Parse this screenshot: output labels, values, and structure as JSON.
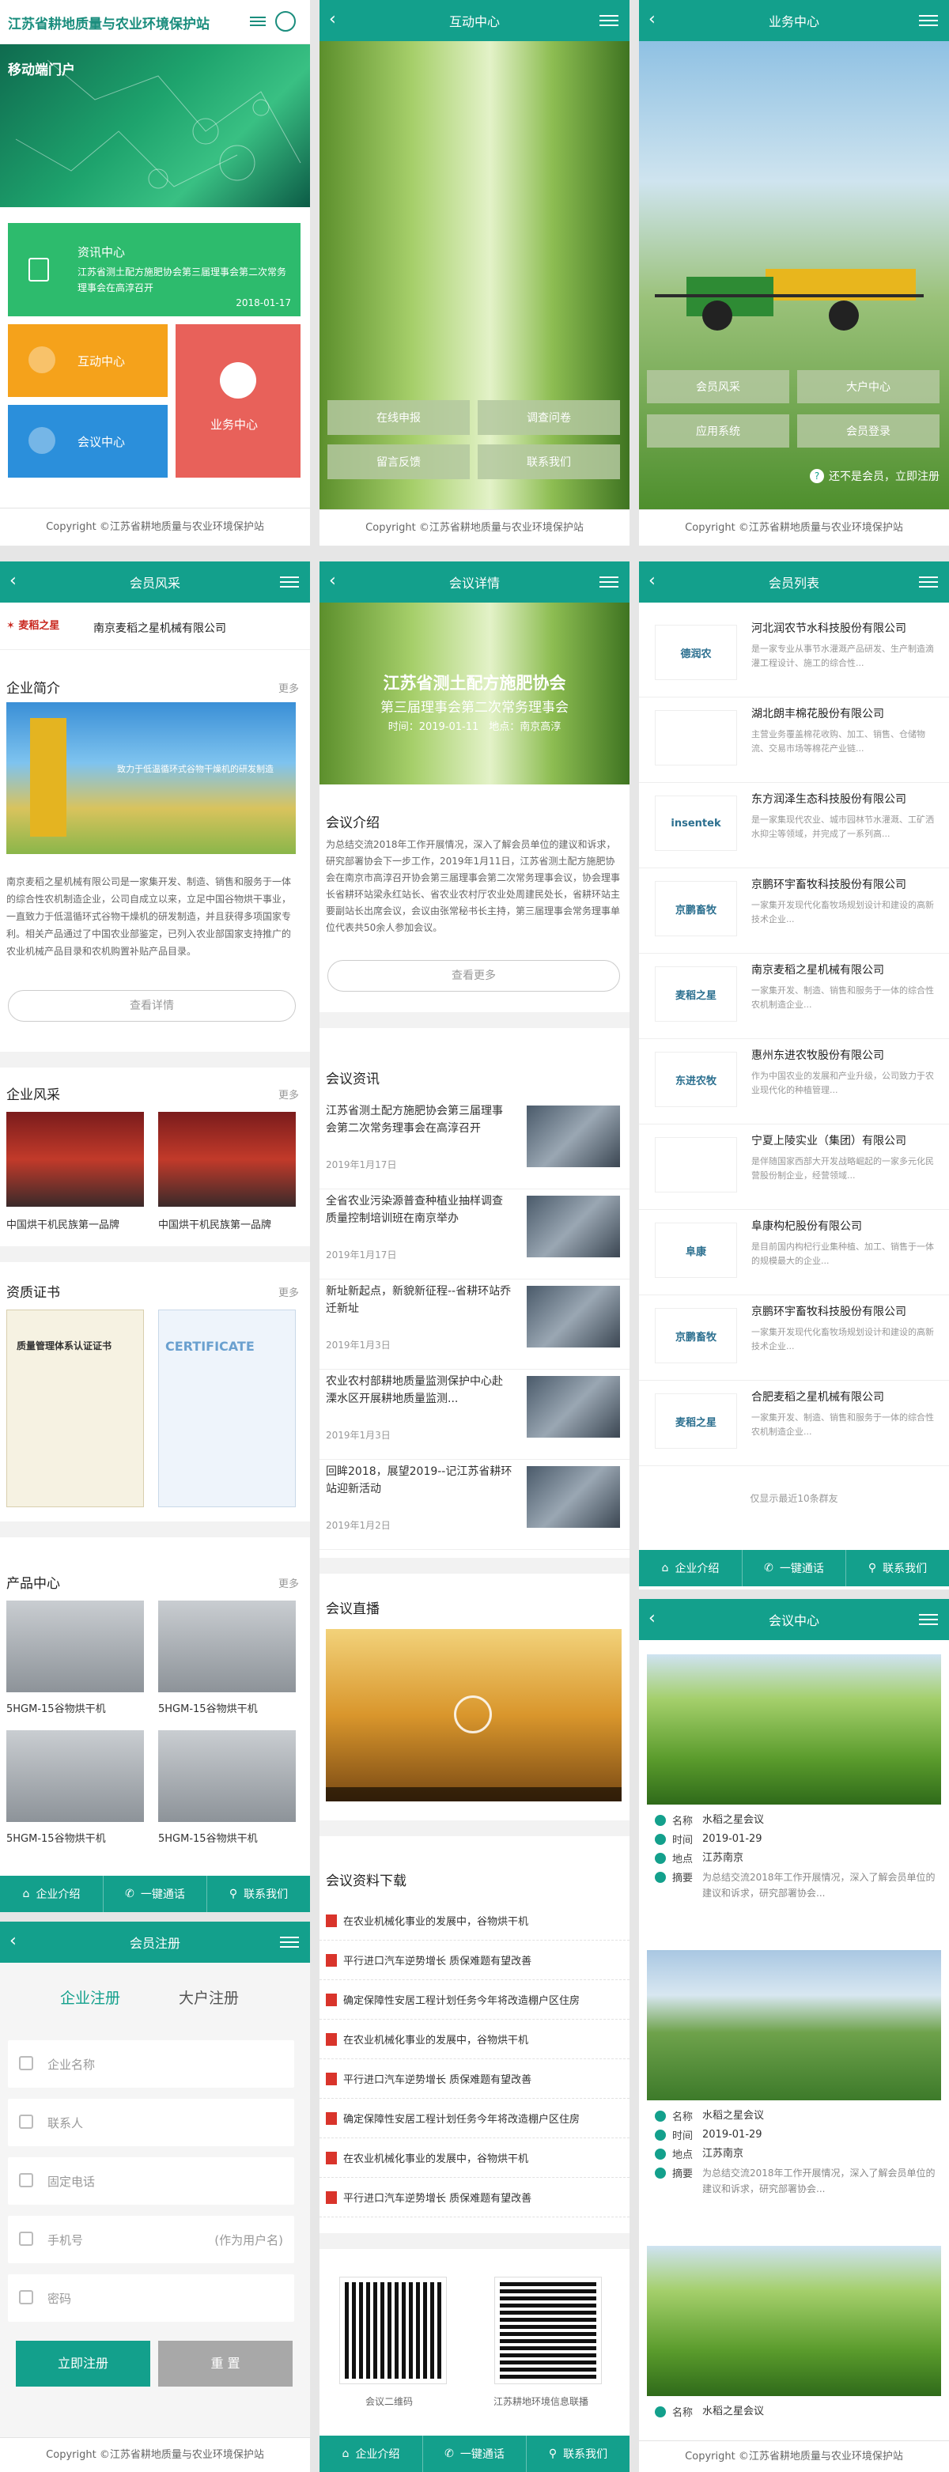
{
  "common": {
    "copyright": "Copyright ©江苏省耕地质量与农业环境保护站",
    "footer": {
      "intro": "企业介绍",
      "call": "一键通话",
      "contact": "联系我们"
    }
  },
  "home": {
    "title": "江苏省耕地质量与农业环境保护站",
    "banner_text": "移动端门户",
    "news_tile": {
      "title": "资讯中心",
      "text": "江苏省测土配方施肥协会第三届理事会第二次常务理事会在高淳召开",
      "date": "2018-01-17"
    },
    "tiles": {
      "interact": "互动中心",
      "meeting": "会议中心",
      "business": "业务中心"
    }
  },
  "interact": {
    "title": "互动中心",
    "buttons": [
      "在线申报",
      "调查问卷",
      "留言反馈",
      "联系我们"
    ]
  },
  "business": {
    "title": "业务中心",
    "buttons": [
      "会员风采",
      "大户中心",
      "应用系统",
      "会员登录"
    ],
    "register_hint": "还不是会员，立即注册"
  },
  "member_style": {
    "title": "会员风采",
    "company": "南京麦稻之星机械有限公司",
    "logo_text": "麦稻之星",
    "intro_title": "企业简介",
    "more": "更多",
    "banner_caption": "致力于低温循环式谷物干燥机的研发制造",
    "intro_text": "南京麦稻之星机械有限公司是一家集开发、制造、销售和服务于一体的综合性农机制造企业，公司自成立以来，立足中国谷物烘干事业，一直致力于低温循环式谷物干燥机的研发制造，并且获得多项国家专利。相关产品通过了中国农业部鉴定，已列入农业部国家支持推广的农业机械产品目录和农机购置补贴产品目录。",
    "detail_button": "查看详情",
    "style_title": "企业风采",
    "style_items": [
      "中国烘干机民族第一品牌",
      "中国烘干机民族第一品牌"
    ],
    "cert_title": "资质证书",
    "cert1": "质量管理体系认证证书",
    "cert2": "CERTIFICATE",
    "product_title": "产品中心",
    "products": [
      "5HGM-15谷物烘干机",
      "5HGM-15谷物烘干机",
      "5HGM-15谷物烘干机",
      "5HGM-15谷物烘干机"
    ]
  },
  "meeting_detail": {
    "title": "会议详情",
    "banner_line1": "江苏省测土配方施肥协会",
    "banner_line2": "第三届理事会第二次常务理事会",
    "banner_line3": "时间：2019-01-11　地点：南京高淳",
    "intro_title": "会议介绍",
    "intro_text": "为总结交流2018年工作开展情况，深入了解会员单位的建议和诉求，研究部署协会下一步工作，2019年1月11日，江苏省测土配方施肥协会在南京市高淳召开协会第三届理事会第二次常务理事会议，协会理事长省耕环站梁永红站长、省农业农村厅农业处周建民处长，省耕环站主要副站长出席会议，会议由张常秘书长主持，第三届理事会常务理事单位代表共50余人参加会议。",
    "more_button": "查看更多",
    "news_title": "会议资讯",
    "news": [
      {
        "t": "江苏省测土配方施肥协会第三届理事会第二次常务理事会在高淳召开",
        "d": "2019年1月17日"
      },
      {
        "t": "全省农业污染源普查种植业抽样调查质量控制培训班在南京举办",
        "d": "2019年1月17日"
      },
      {
        "t": "新址新起点，新貌新征程--省耕环站乔迁新址",
        "d": "2019年1月3日"
      },
      {
        "t": "农业农村部耕地质量监测保护中心赴溧水区开展耕地质量监测...",
        "d": "2019年1月3日"
      },
      {
        "t": "回眸2018，展望2019--记江苏省耕环站迎新活动",
        "d": "2019年1月2日"
      }
    ],
    "live_title": "会议直播",
    "docs_title": "会议资料下载",
    "docs": [
      "在农业机械化事业的发展中，谷物烘干机",
      "平行进口汽车逆势增长 质保难题有望改善",
      "确定保障性安居工程计划任务今年将改造棚户区住房",
      "在农业机械化事业的发展中，谷物烘干机",
      "平行进口汽车逆势增长 质保难题有望改善",
      "确定保障性安居工程计划任务今年将改造棚户区住房",
      "在农业机械化事业的发展中，谷物烘干机",
      "平行进口汽车逆势增长 质保难题有望改善"
    ],
    "qr1": "会议二维码",
    "qr2": "江苏耕地环境信息联播"
  },
  "member_list": {
    "title": "会员列表",
    "members": [
      {
        "n": "河北润农节水科技股份有限公司",
        "d": "是一家专业从事节水灌溉产品研发、生产制造滴灌工程设计、施工的综合性...",
        "logo": "德润农"
      },
      {
        "n": "湖北朗丰棉花股份有限公司",
        "d": "主营业务覆盖棉花收购、加工、销售、仓储物流、交易市场等棉花产业链...",
        "logo": ""
      },
      {
        "n": "东方润泽生态科技股份有限公司",
        "d": "是一家集现代农业、城市园林节水灌溉、工矿洒水抑尘等领域，并完成了一系列高...",
        "logo": "insentek"
      },
      {
        "n": "京鹏环宇畜牧科技股份有限公司",
        "d": "一家集开发现代化畜牧场规划设计和建设的高新技术企业...",
        "logo": "京鹏畜牧"
      },
      {
        "n": "南京麦稻之星机械有限公司",
        "d": "一家集开发、制造、销售和服务于一体的综合性农机制造企业...",
        "logo": "麦稻之星"
      },
      {
        "n": "惠州东进农牧股份有限公司",
        "d": "作为中国农业的发展和产业升级，公司致力于农业现代化的种植管理...",
        "logo": "东进农牧"
      },
      {
        "n": "宁夏上陵实业（集团）有限公司",
        "d": "是伴随国家西部大开发战略崛起的一家多元化民营股份制企业，经营领域...",
        "logo": ""
      },
      {
        "n": "阜康构杞股份有限公司",
        "d": "是目前国内构杞行业集种植、加工、销售于一体的规模最大的企业...",
        "logo": "阜康"
      },
      {
        "n": "京鹏环宇畜牧科技股份有限公司",
        "d": "一家集开发现代化畜牧场规划设计和建设的高新技术企业...",
        "logo": "京鹏畜牧"
      },
      {
        "n": "合肥麦稻之星机械有限公司",
        "d": "一家集开发、制造、销售和服务于一体的综合性农机制造企业...",
        "logo": "麦稻之星"
      }
    ],
    "footer_note": "仅显示最近10条群友"
  },
  "meeting_center": {
    "title": "会议中心",
    "items": [
      {
        "name": "水稻之星会议",
        "time": "2019-01-29",
        "place": "江苏南京",
        "summary": "为总结交流2018年工作开展情况，深入了解会员单位的建议和诉求，研究部署协会..."
      },
      {
        "name": "水稻之星会议",
        "time": "2019-01-29",
        "place": "江苏南京",
        "summary": "为总结交流2018年工作开展情况，深入了解会员单位的建议和诉求，研究部署协会..."
      },
      {
        "name": "水稻之星会议"
      }
    ],
    "labels": {
      "name": "名称",
      "time": "时间",
      "place": "地点",
      "summary": "摘要"
    }
  },
  "register": {
    "title": "会员注册",
    "tab1": "企业注册",
    "tab2": "大户注册",
    "fields": [
      "企业名称",
      "联系人",
      "固定电话",
      "手机号",
      "密码"
    ],
    "phone_hint": "(作为用户名)",
    "submit": "立即注册",
    "reset": "重 置"
  }
}
